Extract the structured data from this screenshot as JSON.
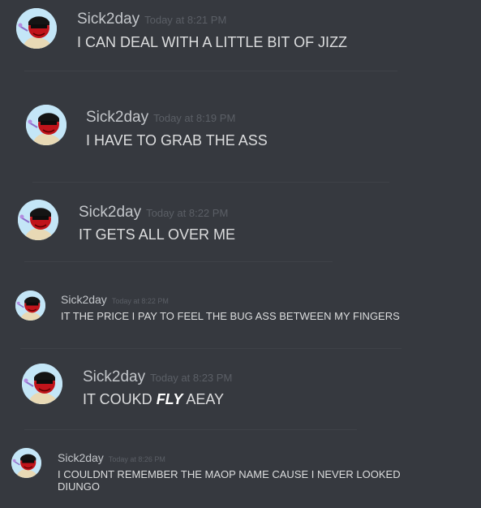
{
  "avatar_icon": "user-avatar-icon",
  "colors": {
    "background": "#36393f",
    "username": "#c3c6ca",
    "timestamp": "#5b5f66",
    "message": "#dcddde"
  },
  "messages": [
    {
      "username": "Sick2day",
      "timestamp": "Today at 8:21 PM",
      "text": "I CAN DEAL WITH A LITTLE BIT OF JIZZ"
    },
    {
      "username": "Sick2day",
      "timestamp": "Today at 8:19 PM",
      "text": "I HAVE TO GRAB THE ASS"
    },
    {
      "username": "Sick2day",
      "timestamp": "Today at 8:22 PM",
      "text": "IT GETS ALL OVER ME"
    },
    {
      "username": "Sick2day",
      "timestamp": "Today at 8:22 PM",
      "text": "IT THE PRICE I PAY TO FEEL THE BUG ASS BETWEEN MY FINGERS"
    },
    {
      "username": "Sick2day",
      "timestamp": "Today at 8:23 PM",
      "text_pre": "IT COUKD ",
      "text_emph": "FLY",
      "text_post": " AEAY"
    },
    {
      "username": "Sick2day",
      "timestamp": "Today at 8:26 PM",
      "text": "I COULDNT REMEMBER THE MAOP NAME CAUSE I NEVER LOOKED DIUNGO"
    }
  ]
}
